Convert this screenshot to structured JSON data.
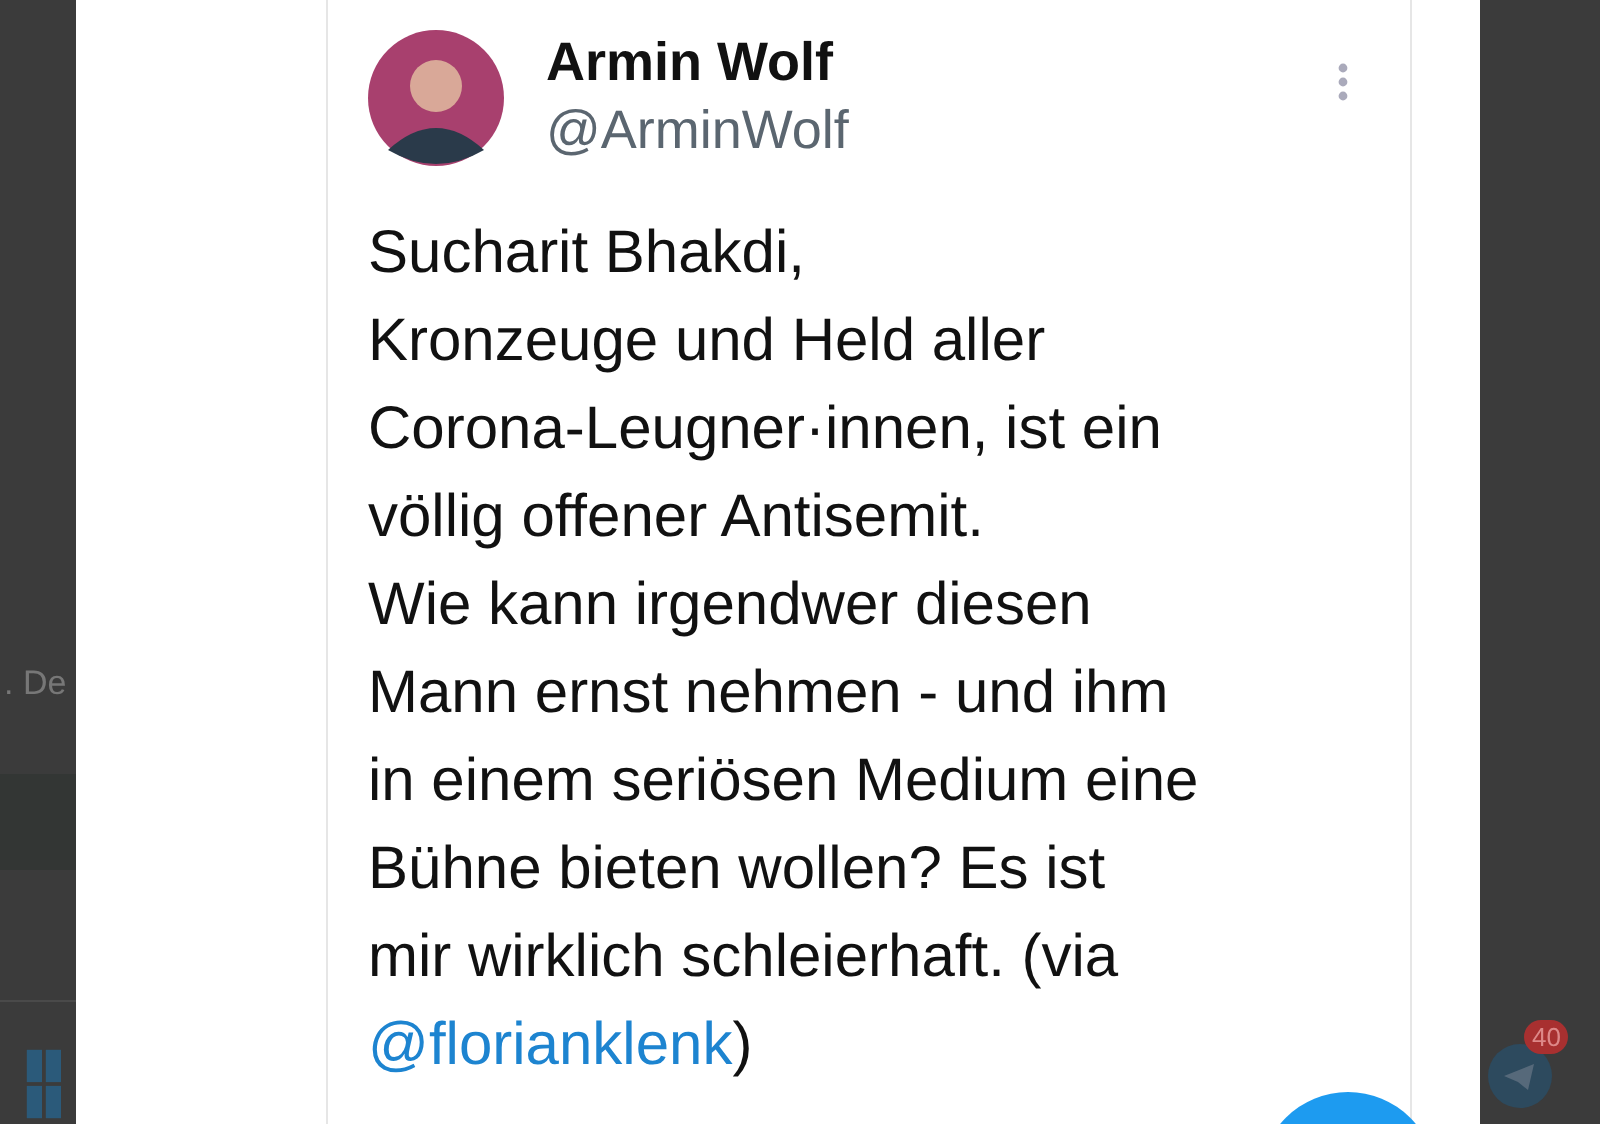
{
  "background_app": {
    "fragment_text": ". De",
    "taskbar_badge": "40"
  },
  "tweet": {
    "name": "Armin Wolf",
    "handle": "@ArminWolf",
    "text_lines": [
      "Sucharit Bhakdi,",
      "Kronzeuge und Held aller",
      "Corona-Leugner·innen, ist ein",
      "völlig offener Antisemit.",
      "Wie kann irgendwer diesen",
      "Mann ernst nehmen - und ihm",
      "in einem seriösen Medium eine",
      "Bühne bieten wollen? Es ist",
      "mir wirklich schleierhaft. (via"
    ],
    "mention": "@florianklenk",
    "mention_suffix": ")"
  }
}
